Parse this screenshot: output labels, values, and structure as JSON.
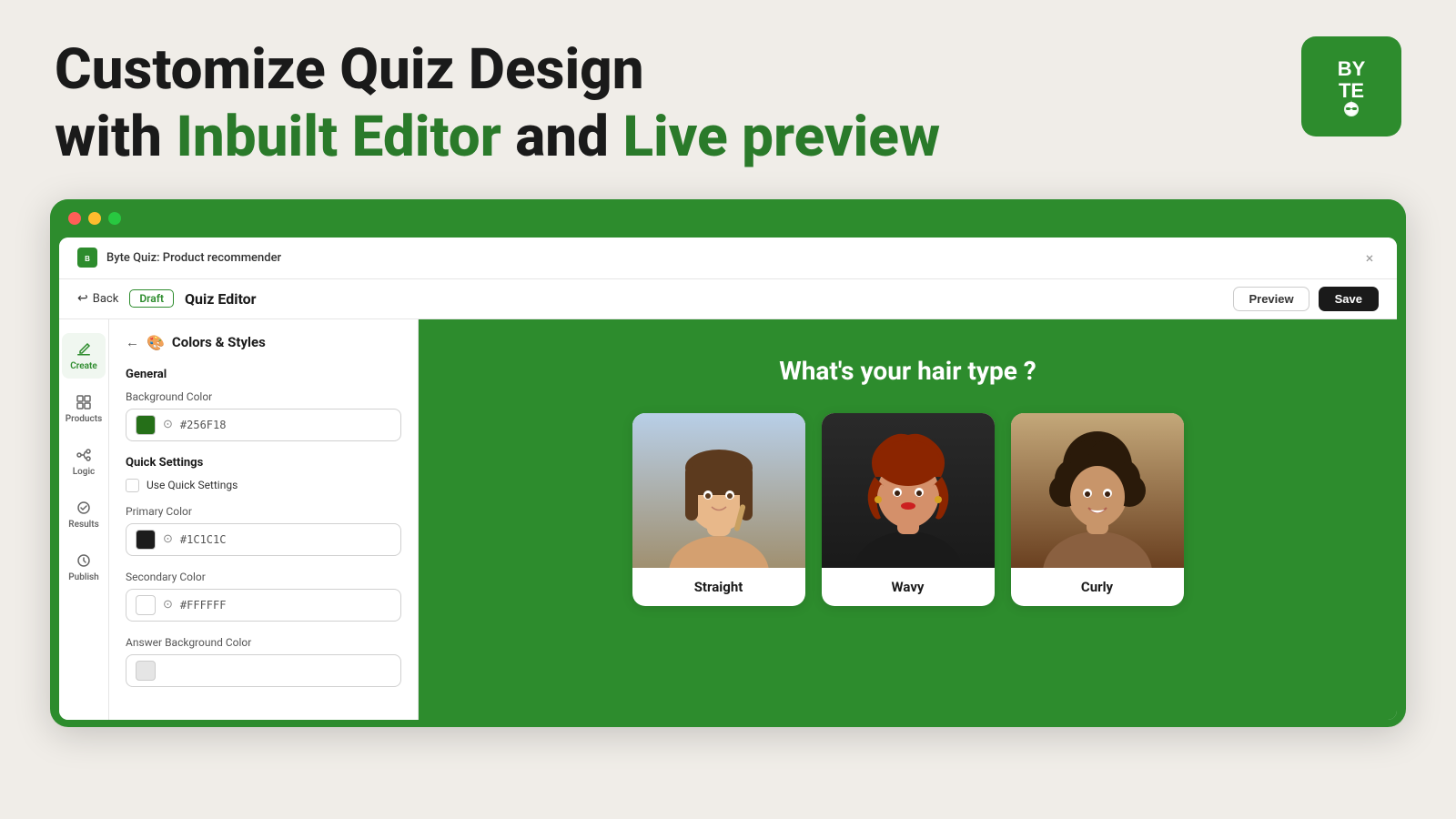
{
  "page": {
    "background_color": "#f0ede8"
  },
  "hero": {
    "line1": "Customize Quiz Design",
    "line2_prefix": "with ",
    "line2_green1": "Inbuilt Editor",
    "line2_middle": " and ",
    "line2_green2": "Live preview"
  },
  "logo": {
    "line1": "BY",
    "line2": "TE",
    "alt": "Byte logo"
  },
  "browser": {
    "dots": [
      "red",
      "yellow",
      "green"
    ]
  },
  "app_window": {
    "title": "Byte Quiz: Product recommender",
    "close_label": "×"
  },
  "toolbar": {
    "back_label": "Back",
    "draft_label": "Draft",
    "quiz_editor_label": "Quiz Editor",
    "preview_label": "Preview",
    "save_label": "Save"
  },
  "sidebar": {
    "items": [
      {
        "id": "create",
        "label": "Create",
        "active": true
      },
      {
        "id": "products",
        "label": "Products",
        "active": false
      },
      {
        "id": "logic",
        "label": "Logic",
        "active": false
      },
      {
        "id": "results",
        "label": "Results",
        "active": false
      },
      {
        "id": "publish",
        "label": "Publish",
        "active": false
      }
    ]
  },
  "settings_panel": {
    "title": "Colors & Styles",
    "general_label": "General",
    "background_color_label": "Background Color",
    "background_color_value": "#256F18",
    "quick_settings_label": "Quick Settings",
    "use_quick_settings_label": "Use Quick Settings",
    "primary_color_label": "Primary Color",
    "primary_color_value": "#1C1C1C",
    "secondary_color_label": "Secondary Color",
    "secondary_color_value": "#FFFFFF",
    "answer_bg_color_label": "Answer Background Color"
  },
  "quiz_preview": {
    "question": "What's your hair type ?",
    "answers": [
      {
        "label": "Straight"
      },
      {
        "label": "Wavy"
      },
      {
        "label": "Curly"
      }
    ]
  }
}
